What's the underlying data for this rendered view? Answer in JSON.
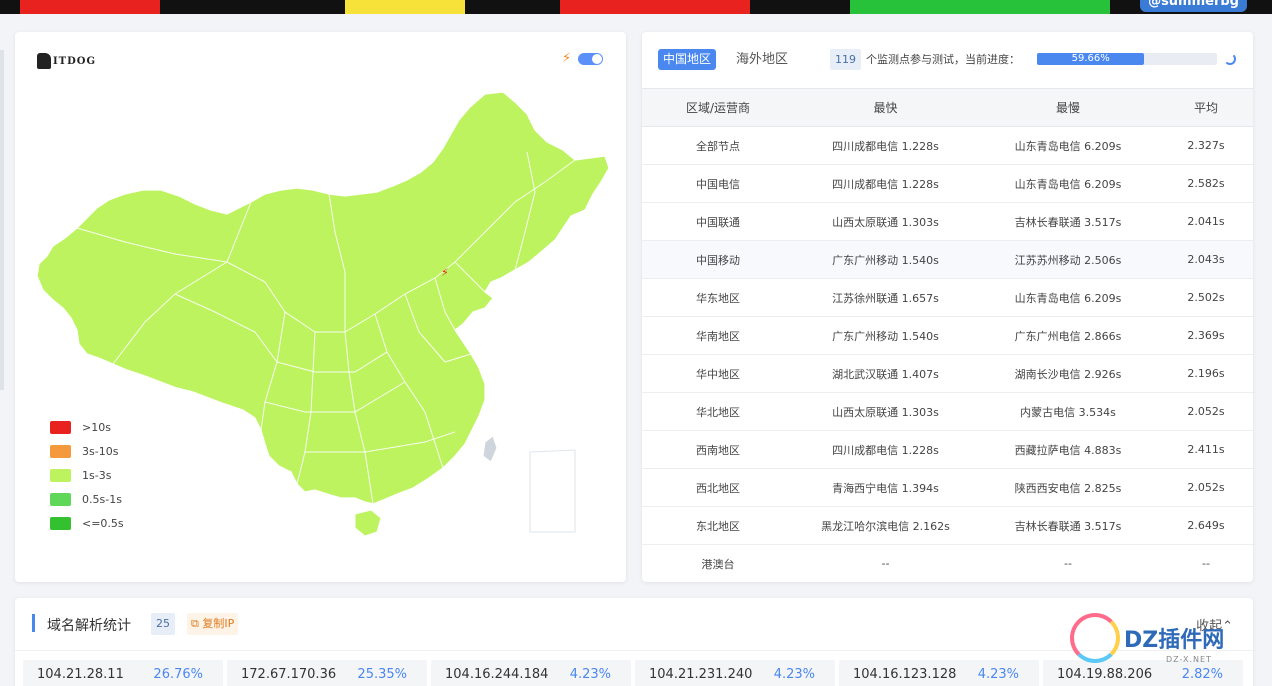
{
  "banner": {
    "handle": "@summerbg"
  },
  "map": {
    "logo_text": "ITDOG",
    "legend": [
      {
        "label": ">10s",
        "color": "#e8231f"
      },
      {
        "label": "3s-10s",
        "color": "#f59a3c"
      },
      {
        "label": "1s-3s",
        "color": "#bdf35f"
      },
      {
        "label": "0.5s-1s",
        "color": "#5fd85a"
      },
      {
        "label": "<=0.5s",
        "color": "#33c12f"
      }
    ],
    "fill_color": "#bdf35f"
  },
  "results": {
    "tab_active": "中国地区",
    "tab_other": "海外地区",
    "count": "119",
    "count_text": "个监测点参与测试，当前进度：",
    "progress_label": "59.66%",
    "progress_value": 0.5966,
    "headers": [
      "区域/运营商",
      "最快",
      "最慢",
      "平均"
    ],
    "rows": [
      [
        "全部节点",
        "四川成都电信 1.228s",
        "山东青岛电信 6.209s",
        "2.327s"
      ],
      [
        "中国电信",
        "四川成都电信 1.228s",
        "山东青岛电信 6.209s",
        "2.582s"
      ],
      [
        "中国联通",
        "山西太原联通 1.303s",
        "吉林长春联通 3.517s",
        "2.041s"
      ],
      [
        "中国移动",
        "广东广州移动 1.540s",
        "江苏苏州移动 2.506s",
        "2.043s"
      ],
      [
        "华东地区",
        "江苏徐州联通 1.657s",
        "山东青岛电信 6.209s",
        "2.502s"
      ],
      [
        "华南地区",
        "广东广州移动 1.540s",
        "广东广州电信 2.866s",
        "2.369s"
      ],
      [
        "华中地区",
        "湖北武汉联通 1.407s",
        "湖南长沙电信 2.926s",
        "2.196s"
      ],
      [
        "华北地区",
        "山西太原联通 1.303s",
        "内蒙古电信 3.534s",
        "2.052s"
      ],
      [
        "西南地区",
        "四川成都电信 1.228s",
        "西藏拉萨电信 4.883s",
        "2.411s"
      ],
      [
        "西北地区",
        "青海西宁电信 1.394s",
        "陕西西安电信 2.825s",
        "2.052s"
      ],
      [
        "东北地区",
        "黑龙江哈尔滨电信 2.162s",
        "吉林长春联通 3.517s",
        "2.649s"
      ],
      [
        "港澳台",
        "--",
        "--",
        "--"
      ]
    ]
  },
  "dns": {
    "title": "域名解析统计",
    "count": "25",
    "copy_label": "复制IP",
    "collapse_label": "收起",
    "ips": [
      {
        "ip": "104.21.28.11",
        "pct": "26.76%"
      },
      {
        "ip": "172.67.170.36",
        "pct": "25.35%"
      },
      {
        "ip": "104.16.244.184",
        "pct": "4.23%"
      },
      {
        "ip": "104.21.231.240",
        "pct": "4.23%"
      },
      {
        "ip": "104.16.123.128",
        "pct": "4.23%"
      },
      {
        "ip": "104.19.88.206",
        "pct": "2.82%"
      }
    ]
  },
  "watermark": {
    "text": "DZ插件网",
    "sub": "DZ-X.NET"
  }
}
